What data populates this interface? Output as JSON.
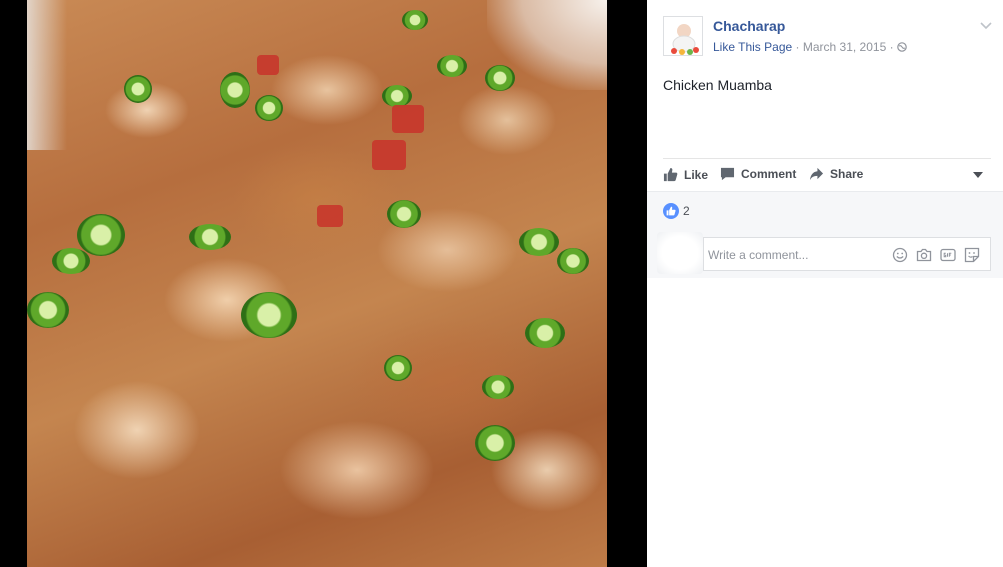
{
  "photo": {
    "subject": ""
  },
  "post": {
    "page_name": "Chacharap",
    "like_page": "Like This Page",
    "separator": "·",
    "date": "March 31, 2015",
    "separator2": "·",
    "text": "Chicken Muamba"
  },
  "actions": {
    "like": "Like",
    "comment": "Comment",
    "share": "Share"
  },
  "reactions": {
    "count": "2"
  },
  "comment_box": {
    "placeholder": "Write a comment..."
  },
  "colors": {
    "link": "#365899",
    "meta": "#90949c",
    "like_blue": "#5890ff"
  },
  "icons": [
    "chevron-down-icon",
    "thumbs-up-icon",
    "comment-icon",
    "share-icon",
    "globe-icon",
    "emoji-icon",
    "camera-icon",
    "gif-icon",
    "sticker-icon"
  ]
}
